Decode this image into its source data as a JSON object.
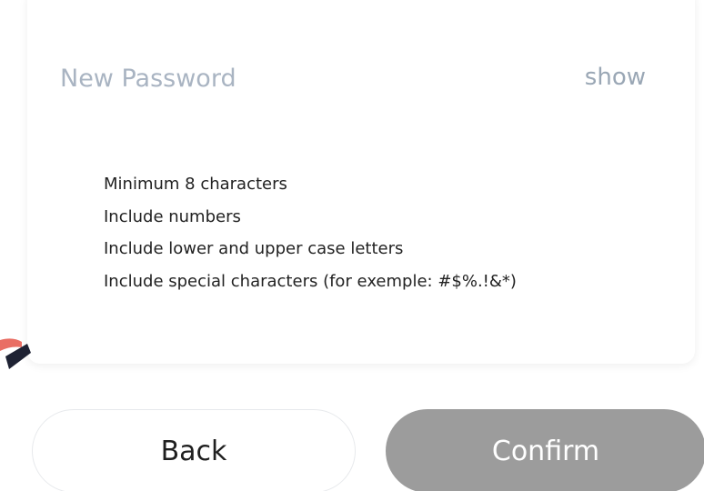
{
  "password": {
    "placeholder": "New Password",
    "value": "",
    "toggle_label": "show"
  },
  "requirements": [
    "Minimum 8 characters",
    "Include numbers",
    "Include lower and upper case letters",
    "Include special characters (for exemple: #$%.!&*)"
  ],
  "actions": {
    "back_label": "Back",
    "confirm_label": "Confirm",
    "confirm_disabled": true
  },
  "colors": {
    "placeholder": "#a9b4c2",
    "toggle": "#9aa7b5",
    "confirm_disabled_bg": "#9c9c9c",
    "text": "#222222"
  }
}
